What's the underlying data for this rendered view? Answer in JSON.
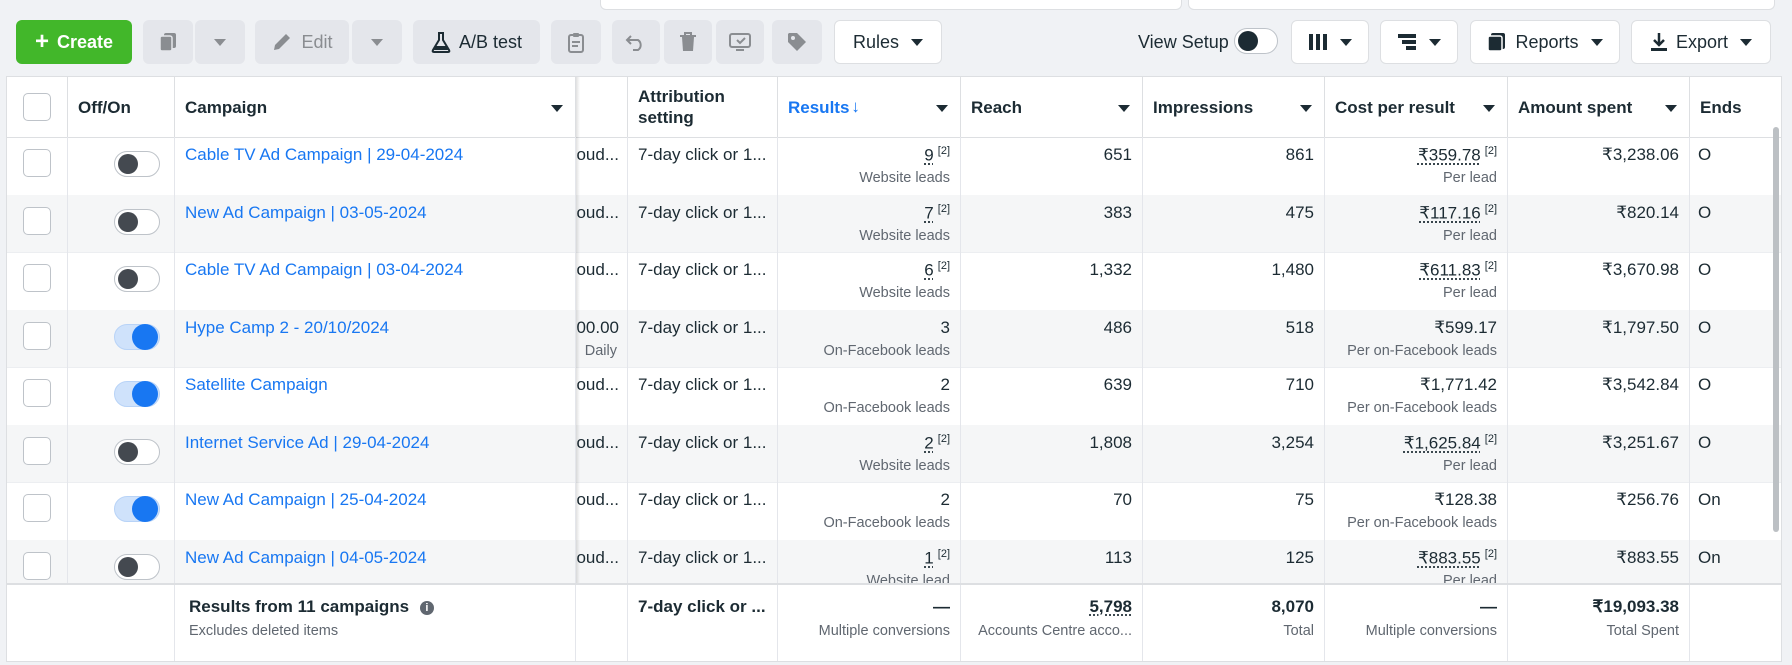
{
  "toolbar": {
    "create_label": "Create",
    "edit_label": "Edit",
    "abtest_label": "A/B test",
    "rules_label": "Rules",
    "view_setup_label": "View Setup",
    "reports_label": "Reports",
    "export_label": "Export"
  },
  "columns": {
    "offon": "Off/On",
    "campaign": "Campaign",
    "attribution": "Attribution setting",
    "results": "Results",
    "reach": "Reach",
    "impressions": "Impressions",
    "cost": "Cost per result",
    "amount": "Amount spent",
    "ends": "Ends"
  },
  "rows": [
    {
      "name": "Cable TV Ad Campaign | 29-04-2024",
      "on": false,
      "budget": "oud...",
      "budget_sub": "",
      "attribution": "7-day click or 1...",
      "results": "9",
      "results_sup": "[2]",
      "results_sub": "Website leads",
      "reach": "651",
      "impressions": "861",
      "cost": "₹359.78",
      "cost_sup": "[2]",
      "cost_sub": "Per lead",
      "amount": "₹3,238.06",
      "ends": "O"
    },
    {
      "name": "New Ad Campaign | 03-05-2024",
      "on": false,
      "budget": "oud...",
      "budget_sub": "",
      "attribution": "7-day click or 1...",
      "results": "7",
      "results_sup": "[2]",
      "results_sub": "Website leads",
      "reach": "383",
      "impressions": "475",
      "cost": "₹117.16",
      "cost_sup": "[2]",
      "cost_sub": "Per lead",
      "amount": "₹820.14",
      "ends": "O"
    },
    {
      "name": "Cable TV Ad Campaign | 03-04-2024",
      "on": false,
      "budget": "oud...",
      "budget_sub": "",
      "attribution": "7-day click or 1...",
      "results": "6",
      "results_sup": "[2]",
      "results_sub": "Website leads",
      "reach": "1,332",
      "impressions": "1,480",
      "cost": "₹611.83",
      "cost_sup": "[2]",
      "cost_sub": "Per lead",
      "amount": "₹3,670.98",
      "ends": "O"
    },
    {
      "name": "Hype Camp 2 - 20/10/2024",
      "on": true,
      "budget": "00.00",
      "budget_sub": "Daily",
      "attribution": "7-day click or 1...",
      "results": "3",
      "results_sup": "",
      "results_sub": "On-Facebook leads",
      "reach": "486",
      "impressions": "518",
      "cost": "₹599.17",
      "cost_sup": "",
      "cost_sub": "Per on-Facebook leads",
      "amount": "₹1,797.50",
      "ends": "O"
    },
    {
      "name": "Satellite Campaign",
      "on": true,
      "budget": "oud...",
      "budget_sub": "",
      "attribution": "7-day click or 1...",
      "results": "2",
      "results_sup": "",
      "results_sub": "On-Facebook leads",
      "reach": "639",
      "impressions": "710",
      "cost": "₹1,771.42",
      "cost_sup": "",
      "cost_sub": "Per on-Facebook leads",
      "amount": "₹3,542.84",
      "ends": "O"
    },
    {
      "name": "Internet Service Ad | 29-04-2024",
      "on": false,
      "budget": "oud...",
      "budget_sub": "",
      "attribution": "7-day click or 1...",
      "results": "2",
      "results_sup": "[2]",
      "results_sub": "Website leads",
      "reach": "1,808",
      "impressions": "3,254",
      "cost": "₹1,625.84",
      "cost_sup": "[2]",
      "cost_sub": "Per lead",
      "amount": "₹3,251.67",
      "ends": "O"
    },
    {
      "name": "New Ad Campaign | 25-04-2024",
      "on": true,
      "budget": "oud...",
      "budget_sub": "",
      "attribution": "7-day click or 1...",
      "results": "2",
      "results_sup": "",
      "results_sub": "On-Facebook leads",
      "reach": "70",
      "impressions": "75",
      "cost": "₹128.38",
      "cost_sup": "",
      "cost_sub": "Per on-Facebook leads",
      "amount": "₹256.76",
      "ends": "On"
    },
    {
      "name": "New Ad Campaign | 04-05-2024",
      "on": false,
      "budget": "oud...",
      "budget_sub": "",
      "attribution": "7-day click or 1...",
      "results": "1",
      "results_sup": "[2]",
      "results_sub": "Website lead",
      "reach": "113",
      "impressions": "125",
      "cost": "₹883.55",
      "cost_sup": "[2]",
      "cost_sub": "Per lead",
      "amount": "₹883.55",
      "ends": "On"
    }
  ],
  "footer": {
    "title": "Results from 11 campaigns",
    "subtitle": "Excludes deleted items",
    "attribution": "7-day click or ...",
    "results": "—",
    "results_sub": "Multiple conversions",
    "reach": "5,798",
    "reach_sub": "Accounts Centre acco...",
    "impressions": "8,070",
    "impressions_sub": "Total",
    "cost": "—",
    "cost_sub": "Multiple conversions",
    "amount": "₹19,093.38",
    "amount_sub": "Total Spent"
  },
  "colors": {
    "accent": "#1877f2",
    "create": "#42b72a"
  }
}
